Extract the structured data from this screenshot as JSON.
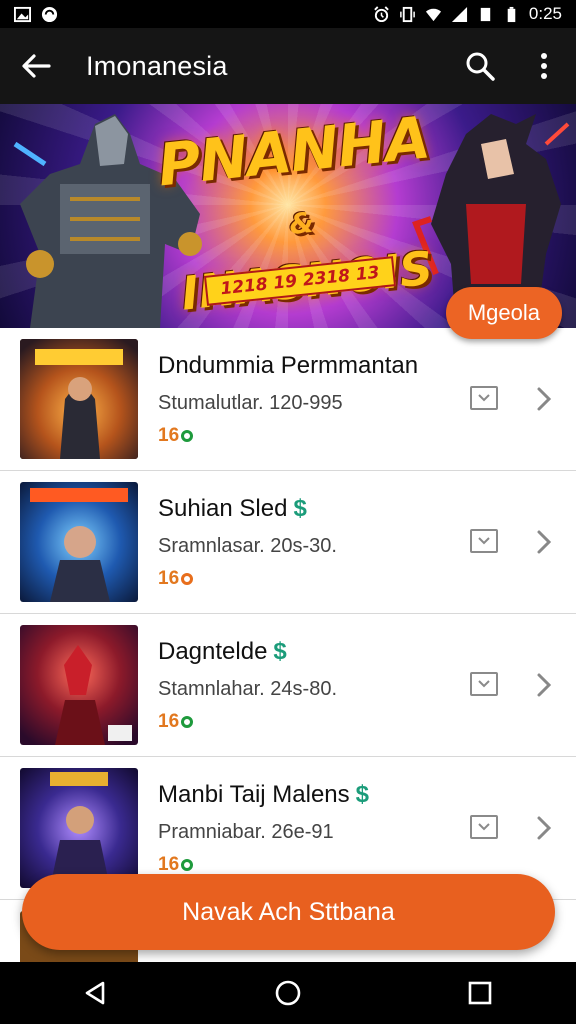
{
  "status_bar": {
    "time": "0:25",
    "icons": [
      "gallery-icon",
      "app-icon",
      "alarm-icon",
      "vibrate-icon",
      "wifi-icon",
      "signal-icon",
      "sim-icon",
      "battery-icon"
    ]
  },
  "app_bar": {
    "title": "Imonanesia",
    "back_icon": "back-arrow-icon",
    "search_icon": "search-icon",
    "menu_icon": "overflow-menu-icon"
  },
  "banner": {
    "title_line1": "PNANHA",
    "title_amp": "&",
    "title_line2": "INASNOIS",
    "ribbon_text": "1218 19 2318 13",
    "chip_label": "Mgeola"
  },
  "list": [
    {
      "title": "Dndummia Permmantan",
      "has_dollar": false,
      "subtitle": "Stumalutlar. 120-995",
      "count": "16",
      "dot_color": "#1e9a3c"
    },
    {
      "title": "Suhian Sled",
      "has_dollar": true,
      "dollar": "$",
      "subtitle": "Sramnlasar. 20s-30.",
      "count": "16",
      "dot_color": "#e86e1c"
    },
    {
      "title": "Dagntelde",
      "has_dollar": true,
      "dollar": "$",
      "subtitle": "Stamnlahar. 24s-80.",
      "count": "16",
      "dot_color": "#1e9a3c"
    },
    {
      "title": "Manbi Taij Malens",
      "has_dollar": true,
      "dollar": "$",
      "subtitle": "Pramniabar. 26e-91",
      "count": "16",
      "dot_color": "#1e9a3c"
    }
  ],
  "cta": {
    "label": "Navak Ach Sttbana"
  },
  "colors": {
    "accent": "#e8601f",
    "app_bar": "#151515",
    "count": "#e2781f",
    "dollar": "#1b9c7a"
  },
  "nav_bar": {
    "back": "nav-back-icon",
    "home": "nav-home-icon",
    "recents": "nav-recents-icon"
  }
}
